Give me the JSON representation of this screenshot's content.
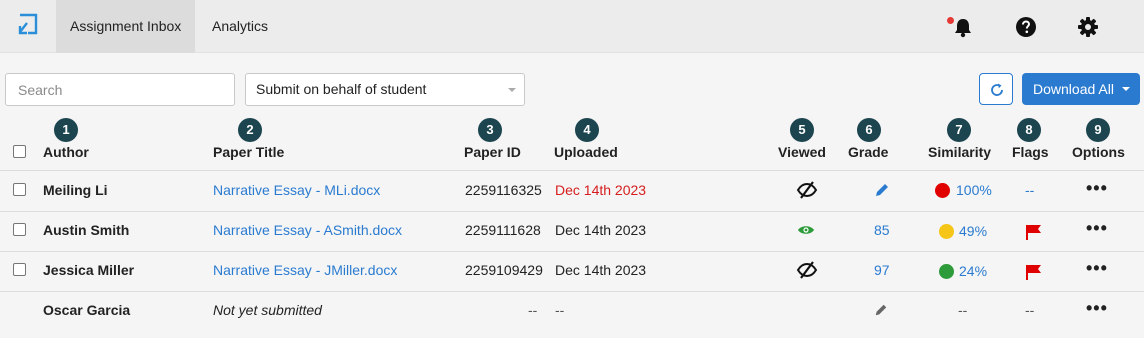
{
  "nav": {
    "tabs": [
      {
        "label": "Assignment Inbox"
      },
      {
        "label": "Analytics"
      }
    ]
  },
  "toolbar": {
    "search_placeholder": "Search",
    "submit_select_value": "Submit on behalf of student",
    "download_label": "Download All"
  },
  "columns": {
    "author": {
      "label": "Author",
      "badge": "1"
    },
    "paper_title": {
      "label": "Paper Title",
      "badge": "2"
    },
    "paper_id": {
      "label": "Paper ID",
      "badge": "3"
    },
    "uploaded": {
      "label": "Uploaded",
      "badge": "4"
    },
    "viewed": {
      "label": "Viewed",
      "badge": "5"
    },
    "grade": {
      "label": "Grade",
      "badge": "6"
    },
    "similarity": {
      "label": "Similarity",
      "badge": "7"
    },
    "flags": {
      "label": "Flags",
      "badge": "8"
    },
    "options": {
      "label": "Options",
      "badge": "9"
    }
  },
  "rows": [
    {
      "author": "Meiling Li",
      "title": "Narrative Essay - MLi.docx",
      "paper_id": "2259116325",
      "uploaded": "Dec 14th 2023",
      "viewed": "hidden",
      "grade": "",
      "similarity": "100%",
      "similarity_color": "#e00000",
      "flags": "--",
      "options": "•••"
    },
    {
      "author": "Austin Smith",
      "title": "Narrative Essay - ASmith.docx",
      "paper_id": "2259111628",
      "uploaded": "Dec 14th 2023",
      "viewed": "visible",
      "grade": "85",
      "similarity": "49%",
      "similarity_color": "#f5c518",
      "flags": "flag",
      "options": "•••"
    },
    {
      "author": "Jessica Miller",
      "title": "Narrative Essay - JMiller.docx",
      "paper_id": "2259109429",
      "uploaded": "Dec 14th 2023",
      "viewed": "hidden",
      "grade": "97",
      "similarity": "24%",
      "similarity_color": "#2e9b3a",
      "flags": "flag",
      "options": "•••"
    },
    {
      "author": "Oscar Garcia",
      "title": "Not yet submitted",
      "paper_id": "--",
      "uploaded": "--",
      "viewed": "",
      "grade": "",
      "similarity": "--",
      "flags": "--",
      "options": "•••"
    }
  ],
  "colors": {
    "accent": "#2a7bd0",
    "badge": "#1d4550",
    "late_date": "#d61e1e",
    "flag": "#e00000"
  }
}
